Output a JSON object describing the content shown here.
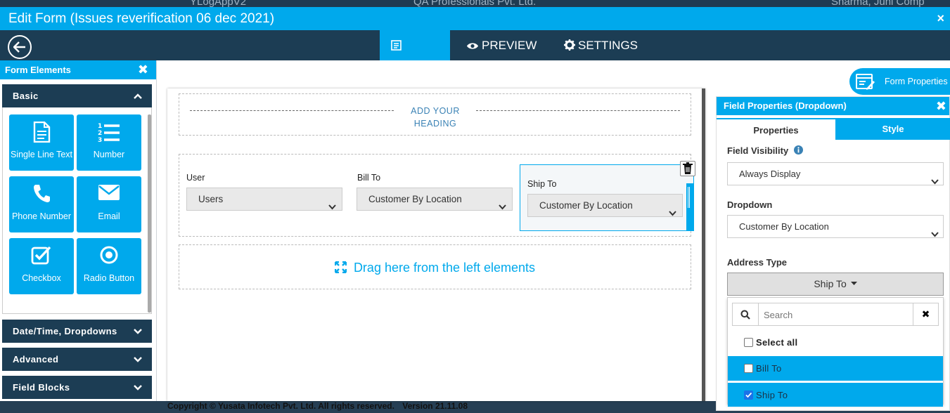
{
  "background_app": {
    "top_left_text": "YLogAppV2",
    "top_center_text": "QA Professionals Pvt. Ltd.",
    "top_right_text": "Sharma, Juhi Comp",
    "footer_copyright": "Copyright © Yusata Infotech Pvt. Ltd. All rights reserved.",
    "footer_version": "Version 21.11.08"
  },
  "modal": {
    "title": "Edit Form (Issues reverification 06 dec 2021)",
    "close_glyph": "×"
  },
  "toolbar": {
    "tabs": [
      {
        "label": "BUILD",
        "active": true
      },
      {
        "label": "PREVIEW",
        "active": false
      },
      {
        "label": "SETTINGS",
        "active": false
      }
    ]
  },
  "left_panel": {
    "title": "Form Elements",
    "sections": {
      "basic": "Basic",
      "datetime": "Date/Time, Dropdowns",
      "advanced": "Advanced",
      "field_blocks": "Field Blocks"
    },
    "elements": [
      {
        "label": "Single Line Text",
        "icon": "document-icon"
      },
      {
        "label": "Number",
        "icon": "numbered-list-icon"
      },
      {
        "label": "Phone Number",
        "icon": "phone-icon"
      },
      {
        "label": "Email",
        "icon": "envelope-icon"
      },
      {
        "label": "Checkbox",
        "icon": "checkbox-icon"
      },
      {
        "label": "Radio Button",
        "icon": "radio-button-icon"
      }
    ]
  },
  "canvas": {
    "heading_placeholder": "ADD YOUR HEADING",
    "fields": [
      {
        "label": "User",
        "value": "Users"
      },
      {
        "label": "Bill To",
        "value": "Customer By Location"
      },
      {
        "label": "Ship To",
        "value": "Customer By Location"
      }
    ],
    "drop_zone_text": "Drag here from the left elements"
  },
  "form_properties_button": "Form Properties",
  "field_properties": {
    "title": "Field Properties (Dropdown)",
    "tabs": {
      "properties": "Properties",
      "style": "Style"
    },
    "field_visibility_label": "Field Visibility",
    "field_visibility_value": "Always Display",
    "dropdown_label": "Dropdown",
    "dropdown_value": "Customer By Location",
    "address_type_label": "Address Type",
    "address_type_value": "Ship To",
    "search_placeholder": "Search",
    "options": [
      {
        "label": "Select all",
        "checked": false,
        "highlighted": false
      },
      {
        "label": "Bill To",
        "checked": false,
        "highlighted": true
      },
      {
        "label": "Ship To",
        "checked": true,
        "highlighted": true
      }
    ]
  },
  "colors": {
    "primary": "#00a9ec",
    "navy": "#1c3d54",
    "checkbox_checked": "#1a73e8"
  }
}
